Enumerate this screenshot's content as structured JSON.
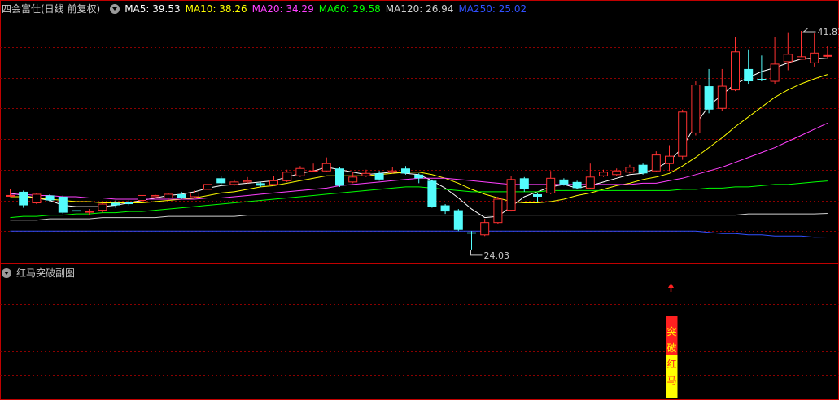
{
  "main_header": {
    "title": "四会富仕(日线 前复权)",
    "ma_labels": [
      {
        "text": "MA5: 39.53",
        "color": "#ffffff"
      },
      {
        "text": "MA10: 38.26",
        "color": "#ffff00"
      },
      {
        "text": "MA20: 34.29",
        "color": "#ff40ff"
      },
      {
        "text": "MA60: 29.58",
        "color": "#00ff00"
      },
      {
        "text": "MA120: 26.94",
        "color": "#d0d0d0"
      },
      {
        "text": "MA250: 25.02",
        "color": "#3050ff"
      }
    ]
  },
  "sub_header": {
    "title": "红马突破副图"
  },
  "colors": {
    "up": "#ff3232",
    "down": "#54fcfc",
    "grid": "#8b0000",
    "bg": "#000000"
  },
  "chart_data": {
    "type": "candlestick",
    "y_range": [
      23.0,
      43.0
    ],
    "annotations": {
      "high_label": "41.81",
      "low_label": "24.03"
    },
    "candles": [
      [
        28.4,
        28.4,
        28.3,
        28.9
      ],
      [
        28.7,
        27.6,
        27.4,
        28.8
      ],
      [
        27.8,
        28.5,
        27.7,
        28.6
      ],
      [
        28.4,
        28.0,
        27.9,
        28.5
      ],
      [
        28.3,
        27.0,
        26.9,
        28.4
      ],
      [
        27.2,
        27.1,
        26.9,
        27.3
      ],
      [
        27.1,
        27.1,
        26.8,
        27.3
      ],
      [
        27.2,
        27.7,
        27.0,
        27.8
      ],
      [
        27.8,
        27.6,
        27.4,
        28.0
      ],
      [
        27.9,
        27.7,
        27.6,
        28.0
      ],
      [
        28.0,
        28.4,
        27.9,
        28.5
      ],
      [
        28.3,
        28.4,
        28.2,
        28.5
      ],
      [
        28.2,
        28.5,
        28.0,
        28.6
      ],
      [
        28.5,
        28.2,
        28.1,
        28.7
      ],
      [
        28.3,
        28.6,
        28.2,
        28.8
      ],
      [
        28.9,
        29.3,
        28.8,
        29.5
      ],
      [
        29.8,
        29.4,
        29.2,
        30.0
      ],
      [
        29.3,
        29.5,
        29.2,
        29.7
      ],
      [
        29.5,
        29.6,
        29.4,
        29.9
      ],
      [
        29.4,
        29.2,
        29.1,
        29.5
      ],
      [
        29.3,
        29.6,
        29.2,
        30.0
      ],
      [
        29.6,
        30.3,
        29.5,
        30.5
      ],
      [
        30.0,
        30.6,
        29.9,
        30.8
      ],
      [
        30.4,
        30.4,
        30.3,
        31.0
      ],
      [
        30.4,
        31.0,
        30.3,
        31.5
      ],
      [
        30.6,
        29.2,
        29.1,
        30.7
      ],
      [
        29.5,
        29.9,
        29.4,
        30.3
      ],
      [
        30.0,
        30.2,
        29.9,
        30.5
      ],
      [
        30.2,
        29.7,
        29.6,
        30.4
      ],
      [
        30.3,
        30.4,
        30.2,
        30.7
      ],
      [
        30.6,
        30.2,
        30.1,
        30.8
      ],
      [
        30.1,
        29.8,
        29.4,
        30.2
      ],
      [
        29.6,
        27.5,
        27.4,
        29.7
      ],
      [
        27.6,
        27.1,
        26.9,
        27.7
      ],
      [
        27.2,
        25.6,
        25.5,
        27.3
      ],
      [
        25.4,
        25.3,
        24.0,
        25.5
      ],
      [
        25.2,
        26.2,
        25.1,
        26.5
      ],
      [
        26.2,
        28.1,
        26.1,
        28.3
      ],
      [
        27.2,
        29.7,
        27.1,
        30.0
      ],
      [
        29.8,
        28.9,
        28.7,
        29.9
      ],
      [
        28.5,
        28.3,
        27.9,
        28.6
      ],
      [
        28.6,
        29.8,
        28.5,
        30.4
      ],
      [
        29.7,
        29.3,
        29.2,
        29.8
      ],
      [
        29.5,
        29.0,
        28.9,
        29.6
      ],
      [
        29.0,
        29.9,
        28.9,
        31.0
      ],
      [
        30.0,
        30.3,
        29.9,
        30.5
      ],
      [
        30.1,
        30.4,
        30.0,
        30.6
      ],
      [
        30.3,
        30.7,
        30.2,
        30.9
      ],
      [
        30.9,
        30.2,
        30.1,
        31.0
      ],
      [
        30.4,
        31.7,
        30.3,
        32.0
      ],
      [
        31.0,
        31.6,
        30.4,
        32.5
      ],
      [
        31.6,
        35.2,
        31.3,
        35.4
      ],
      [
        33.5,
        37.4,
        33.3,
        37.7
      ],
      [
        37.3,
        35.4,
        35.1,
        38.7
      ],
      [
        35.5,
        37.3,
        35.3,
        38.7
      ],
      [
        37.0,
        40.1,
        36.9,
        41.3
      ],
      [
        38.7,
        37.7,
        37.5,
        40.3
      ],
      [
        37.9,
        37.8,
        37.7,
        39.8
      ],
      [
        37.7,
        39.1,
        37.5,
        41.3
      ],
      [
        39.3,
        39.9,
        38.6,
        41.7
      ],
      [
        39.5,
        39.7,
        39.5,
        41.81
      ],
      [
        39.2,
        40.0,
        38.9,
        41.6
      ],
      [
        39.8,
        39.8,
        39.6,
        40.6
      ]
    ],
    "series": [
      {
        "name": "MA5",
        "color": "#ffffff",
        "values": [
          28.6,
          28.4,
          28.2,
          28.0,
          27.6,
          27.5,
          27.5,
          27.5,
          27.6,
          27.8,
          28.0,
          28.2,
          28.4,
          28.5,
          28.7,
          29.0,
          29.2,
          29.3,
          29.4,
          29.5,
          29.6,
          29.9,
          30.2,
          30.4,
          30.7,
          30.5,
          30.3,
          30.1,
          30.2,
          30.3,
          30.2,
          30.1,
          29.6,
          29.0,
          28.2,
          27.3,
          26.6,
          26.7,
          27.5,
          28.3,
          28.7,
          29.1,
          29.3,
          29.0,
          29.2,
          29.5,
          29.8,
          30.1,
          30.2,
          30.6,
          31.2,
          32.3,
          34.2,
          35.7,
          36.6,
          37.5,
          38.0,
          38.5,
          38.8,
          39.2,
          39.5,
          39.6,
          39.53
        ]
      },
      {
        "name": "MA10",
        "color": "#ffff00",
        "values": [
          28.3,
          28.3,
          28.2,
          28.1,
          28.0,
          27.9,
          27.9,
          27.8,
          27.8,
          27.8,
          27.8,
          27.9,
          28.0,
          28.1,
          28.2,
          28.4,
          28.6,
          28.7,
          28.9,
          29.1,
          29.2,
          29.4,
          29.6,
          29.8,
          30.0,
          30.0,
          30.0,
          30.0,
          30.1,
          30.2,
          30.3,
          30.3,
          30.1,
          29.8,
          29.4,
          28.9,
          28.5,
          28.2,
          27.9,
          27.8,
          27.8,
          27.9,
          28.1,
          28.4,
          28.6,
          28.9,
          29.2,
          29.4,
          29.7,
          29.9,
          30.2,
          30.8,
          31.5,
          32.3,
          33.1,
          34.0,
          34.8,
          35.6,
          36.4,
          37.0,
          37.5,
          37.9,
          38.26
        ]
      },
      {
        "name": "MA20",
        "color": "#ff40ff",
        "values": [
          28.5,
          28.5,
          28.4,
          28.4,
          28.3,
          28.3,
          28.2,
          28.2,
          28.1,
          28.1,
          28.1,
          28.1,
          28.1,
          28.1,
          28.1,
          28.2,
          28.2,
          28.3,
          28.4,
          28.5,
          28.6,
          28.7,
          28.8,
          28.9,
          29.0,
          29.2,
          29.3,
          29.4,
          29.5,
          29.6,
          29.7,
          29.8,
          29.8,
          29.8,
          29.7,
          29.6,
          29.5,
          29.4,
          29.3,
          29.3,
          29.3,
          29.3,
          29.3,
          29.3,
          29.3,
          29.3,
          29.3,
          29.3,
          29.4,
          29.4,
          29.6,
          29.8,
          30.1,
          30.4,
          30.7,
          31.1,
          31.5,
          31.9,
          32.3,
          32.8,
          33.3,
          33.8,
          34.29
        ]
      },
      {
        "name": "MA60",
        "color": "#00ff00",
        "values": [
          26.6,
          26.7,
          26.7,
          26.8,
          26.8,
          26.9,
          26.9,
          27.0,
          27.0,
          27.1,
          27.1,
          27.2,
          27.3,
          27.4,
          27.5,
          27.6,
          27.7,
          27.8,
          27.9,
          28.0,
          28.1,
          28.2,
          28.3,
          28.4,
          28.5,
          28.6,
          28.7,
          28.8,
          28.9,
          29.0,
          29.1,
          29.1,
          29.0,
          28.9,
          28.8,
          28.7,
          28.7,
          28.7,
          28.7,
          28.7,
          28.7,
          28.8,
          28.8,
          28.8,
          28.8,
          28.8,
          28.8,
          28.8,
          28.8,
          28.8,
          28.8,
          28.9,
          28.9,
          29.0,
          29.0,
          29.1,
          29.1,
          29.2,
          29.3,
          29.3,
          29.4,
          29.5,
          29.58
        ]
      },
      {
        "name": "MA120",
        "color": "#d0d0d0",
        "values": [
          26.4,
          26.4,
          26.4,
          26.5,
          26.5,
          26.5,
          26.5,
          26.6,
          26.6,
          26.6,
          26.6,
          26.6,
          26.7,
          26.7,
          26.7,
          26.7,
          26.7,
          26.7,
          26.8,
          26.8,
          26.8,
          26.8,
          26.8,
          26.8,
          26.8,
          26.8,
          26.8,
          26.8,
          26.8,
          26.8,
          26.8,
          26.8,
          26.8,
          26.8,
          26.8,
          26.8,
          26.8,
          26.8,
          26.8,
          26.8,
          26.8,
          26.8,
          26.8,
          26.8,
          26.8,
          26.8,
          26.8,
          26.8,
          26.8,
          26.8,
          26.8,
          26.8,
          26.8,
          26.8,
          26.8,
          26.8,
          26.9,
          26.9,
          26.9,
          26.9,
          26.9,
          26.9,
          26.94
        ]
      },
      {
        "name": "MA250",
        "color": "#3050ff",
        "values": [
          25.5,
          25.5,
          25.5,
          25.5,
          25.5,
          25.5,
          25.5,
          25.5,
          25.5,
          25.5,
          25.5,
          25.5,
          25.5,
          25.5,
          25.5,
          25.5,
          25.5,
          25.5,
          25.5,
          25.5,
          25.5,
          25.5,
          25.5,
          25.5,
          25.5,
          25.5,
          25.5,
          25.5,
          25.5,
          25.5,
          25.5,
          25.5,
          25.5,
          25.5,
          25.5,
          25.5,
          25.5,
          25.5,
          25.5,
          25.5,
          25.5,
          25.5,
          25.5,
          25.5,
          25.5,
          25.5,
          25.5,
          25.5,
          25.5,
          25.5,
          25.5,
          25.5,
          25.5,
          25.4,
          25.3,
          25.3,
          25.2,
          25.2,
          25.1,
          25.1,
          25.1,
          25.0,
          25.02
        ]
      }
    ],
    "sub_indicator": {
      "signal_index": 50,
      "bar_text": [
        "突",
        "破",
        "红",
        "马"
      ],
      "top_color": "#ff2020",
      "bottom_color": "#ffff00",
      "arrow_color": "#ff2020"
    }
  }
}
